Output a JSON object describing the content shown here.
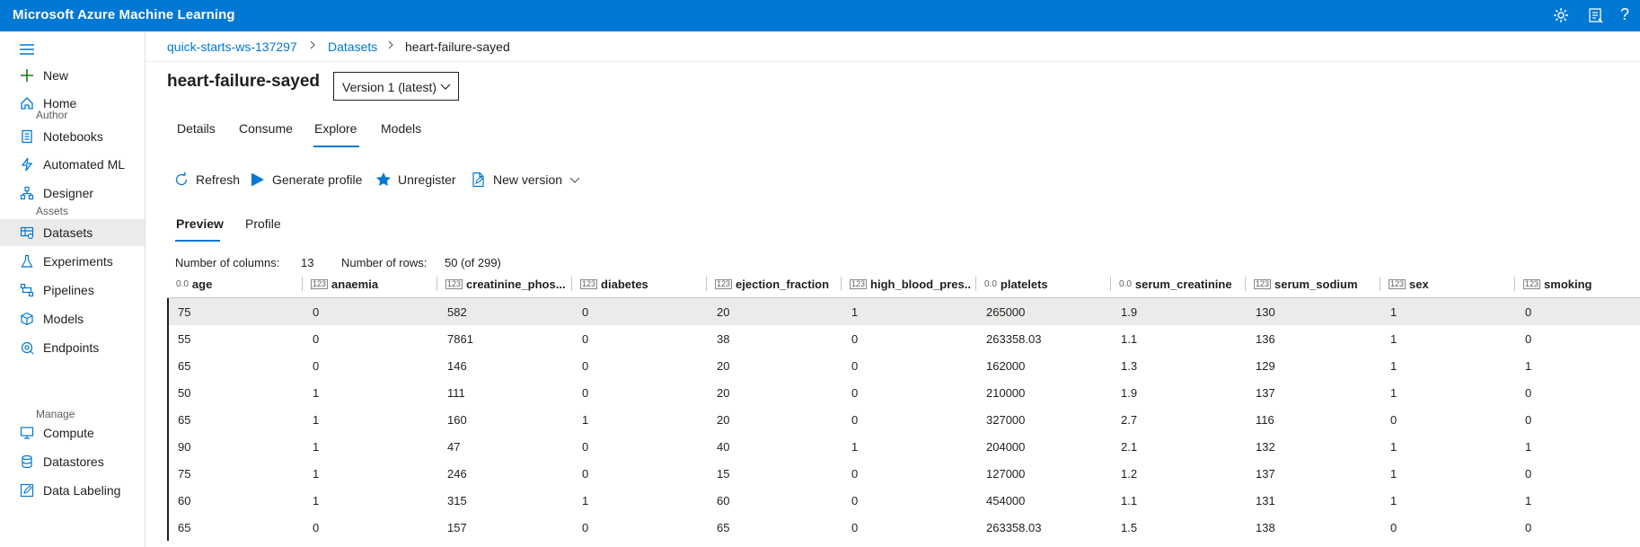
{
  "app": {
    "title": "Microsoft Azure Machine Learning"
  },
  "topbar": {
    "icons": [
      "gear-icon",
      "feedback-icon",
      "help-icon"
    ],
    "help_glyph": "?"
  },
  "sidebar": {
    "new_label": "New",
    "home_label": "Home",
    "sections": {
      "author": "Author",
      "assets": "Assets",
      "manage": "Manage"
    },
    "items": {
      "notebooks": "Notebooks",
      "automl": "Automated ML",
      "designer": "Designer",
      "datasets": "Datasets",
      "experiments": "Experiments",
      "pipelines": "Pipelines",
      "models": "Models",
      "endpoints": "Endpoints",
      "compute": "Compute",
      "datastores": "Datastores",
      "labeling": "Data Labeling"
    }
  },
  "breadcrumb": {
    "workspace": "quick-starts-ws-137297",
    "datasets": "Datasets",
    "current": "heart-failure-sayed"
  },
  "page": {
    "title": "heart-failure-sayed",
    "version": "Version 1 (latest)"
  },
  "tabs": {
    "details": "Details",
    "consume": "Consume",
    "explore": "Explore",
    "models": "Models",
    "active": "Explore"
  },
  "commands": {
    "refresh": "Refresh",
    "generate_profile": "Generate profile",
    "unregister": "Unregister",
    "new_version": "New version"
  },
  "subtabs": {
    "preview": "Preview",
    "profile": "Profile",
    "active": "Preview"
  },
  "counts": {
    "columns_label": "Number of columns:",
    "columns_value": "13",
    "rows_label": "Number of rows:",
    "rows_value": "50 (of 299)"
  },
  "type_glyphs": {
    "float": "0.0",
    "int": "123"
  },
  "table": {
    "columns": [
      {
        "name": "age",
        "type": "float"
      },
      {
        "name": "anaemia",
        "type": "int"
      },
      {
        "name": "creatinine_phos...",
        "type": "int"
      },
      {
        "name": "diabetes",
        "type": "int"
      },
      {
        "name": "ejection_fraction",
        "type": "int"
      },
      {
        "name": "high_blood_pres...",
        "type": "int"
      },
      {
        "name": "platelets",
        "type": "float"
      },
      {
        "name": "serum_creatinine",
        "type": "float"
      },
      {
        "name": "serum_sodium",
        "type": "int"
      },
      {
        "name": "sex",
        "type": "int"
      },
      {
        "name": "smoking",
        "type": "int"
      }
    ],
    "rows": [
      [
        "75",
        "0",
        "582",
        "0",
        "20",
        "1",
        "265000",
        "1.9",
        "130",
        "1",
        "0"
      ],
      [
        "55",
        "0",
        "7861",
        "0",
        "38",
        "0",
        "263358.03",
        "1.1",
        "136",
        "1",
        "0"
      ],
      [
        "65",
        "0",
        "146",
        "0",
        "20",
        "0",
        "162000",
        "1.3",
        "129",
        "1",
        "1"
      ],
      [
        "50",
        "1",
        "111",
        "0",
        "20",
        "0",
        "210000",
        "1.9",
        "137",
        "1",
        "0"
      ],
      [
        "65",
        "1",
        "160",
        "1",
        "20",
        "0",
        "327000",
        "2.7",
        "116",
        "0",
        "0"
      ],
      [
        "90",
        "1",
        "47",
        "0",
        "40",
        "1",
        "204000",
        "2.1",
        "132",
        "1",
        "1"
      ],
      [
        "75",
        "1",
        "246",
        "0",
        "15",
        "0",
        "127000",
        "1.2",
        "137",
        "1",
        "0"
      ],
      [
        "60",
        "1",
        "315",
        "1",
        "60",
        "0",
        "454000",
        "1.1",
        "131",
        "1",
        "1"
      ],
      [
        "65",
        "0",
        "157",
        "0",
        "65",
        "0",
        "263358.03",
        "1.5",
        "138",
        "0",
        "0"
      ]
    ]
  }
}
